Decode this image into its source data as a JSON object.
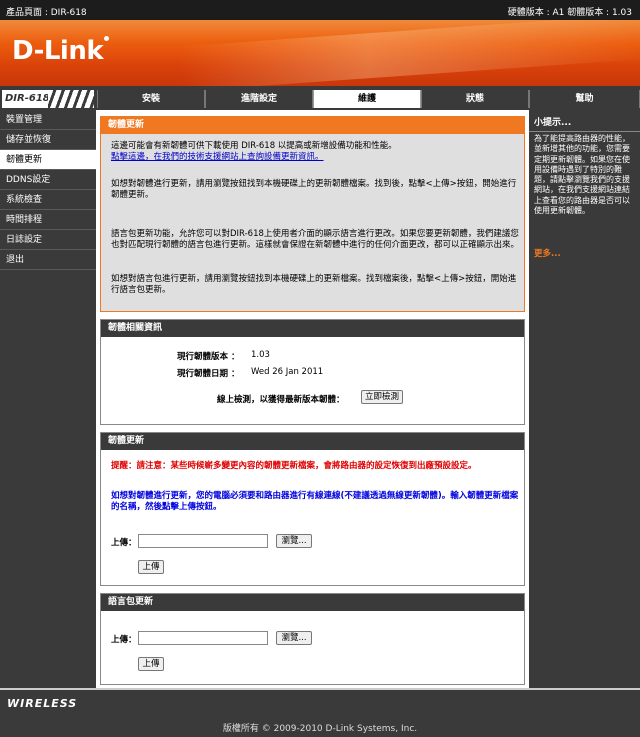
{
  "topbar": {
    "product_page": "產品頁面 : DIR-618",
    "versions": "硬體版本 : A1   韌體版本 : 1.03"
  },
  "brand": {
    "logo_text": "D-Link"
  },
  "model": "DIR-618",
  "tabs": [
    "安裝",
    "進階設定",
    "維護",
    "狀態",
    "幫助"
  ],
  "active_tab": 2,
  "sidebar": {
    "items": [
      "裝置管理",
      "儲存並恢復",
      "韌體更新",
      "DDNS設定",
      "系統檢查",
      "時間排程",
      "日誌設定",
      "退出"
    ],
    "active_index": 2
  },
  "firmware_update_intro": {
    "title": "韌體更新",
    "p1": "這邊可能會有新韌體可供下載使用 DIR-618 以提高或新增設備功能和性能。",
    "p1_link": "點擊這邊，在我們的技術支援網站上查詢設備更新資訊。",
    "p2": "如想對韌體進行更新，請用瀏覽按鈕找到本機硬碟上的更新韌體檔案。找到後，點擊<上傳>按鈕，開始進行韌體更新。",
    "p3": "語言包更新功能，允許您可以對DIR-618上使用者介面的顯示語言進行更改。如果您要更新韌體，我們建議您也對匹配現行韌體的語言包進行更新。這樣就會保證在新韌體中進行的任何介面更改，都可以正確顯示出來。",
    "p4": "如想對語言包進行更新，請用瀏覽按鈕找到本機硬碟上的更新檔案。找到檔案後，點擊<上傳>按鈕，開始進行語言包更新。"
  },
  "firmware_info": {
    "title": "韌體相關資訊",
    "current_version_label": "現行韌體版本 ：",
    "current_version": "1.03",
    "current_date_label": "現行韌體日期 ：",
    "current_date": "Wed 26 Jan 2011",
    "check_label": "線上檢測，以獲得最新版本韌體：",
    "check_button": "立即檢測"
  },
  "firmware_upload": {
    "title": "韌體更新",
    "warning": "提醒：請注意：某些時候嶄多變更內容的韌體更新檔案，會將路由器的設定恢復到出廠預設設定。",
    "instruction": "如想對韌體進行更新，您的電腦必須要和路由器進行有線連線(不建議透過無線更新韌體)。輸入韌體更新檔案的名稱，然後點擊上傳按鈕。",
    "upload_label": "上傳：",
    "browse_button": "瀏覽...",
    "upload_button": "上傳"
  },
  "language_update": {
    "title": "語言包更新",
    "upload_label": "上傳：",
    "browse_button": "瀏覽...",
    "upload_button": "上傳"
  },
  "hints": {
    "title": "小提示...",
    "text": "為了能提高路由器的性能，並新增其他的功能，您需要定期更新韌體。如果您在使用設備時遇到了特別的難題，請點擊瀏覽我們的支援網站，在我們支援網站連結上查看您的路由器是否可以使用更新韌體。",
    "more": "更多..."
  },
  "bottom": {
    "wireless": "WIRELESS"
  },
  "footer": {
    "copyright": "版權所有 © 2009-2010 D-Link Systems, Inc."
  }
}
